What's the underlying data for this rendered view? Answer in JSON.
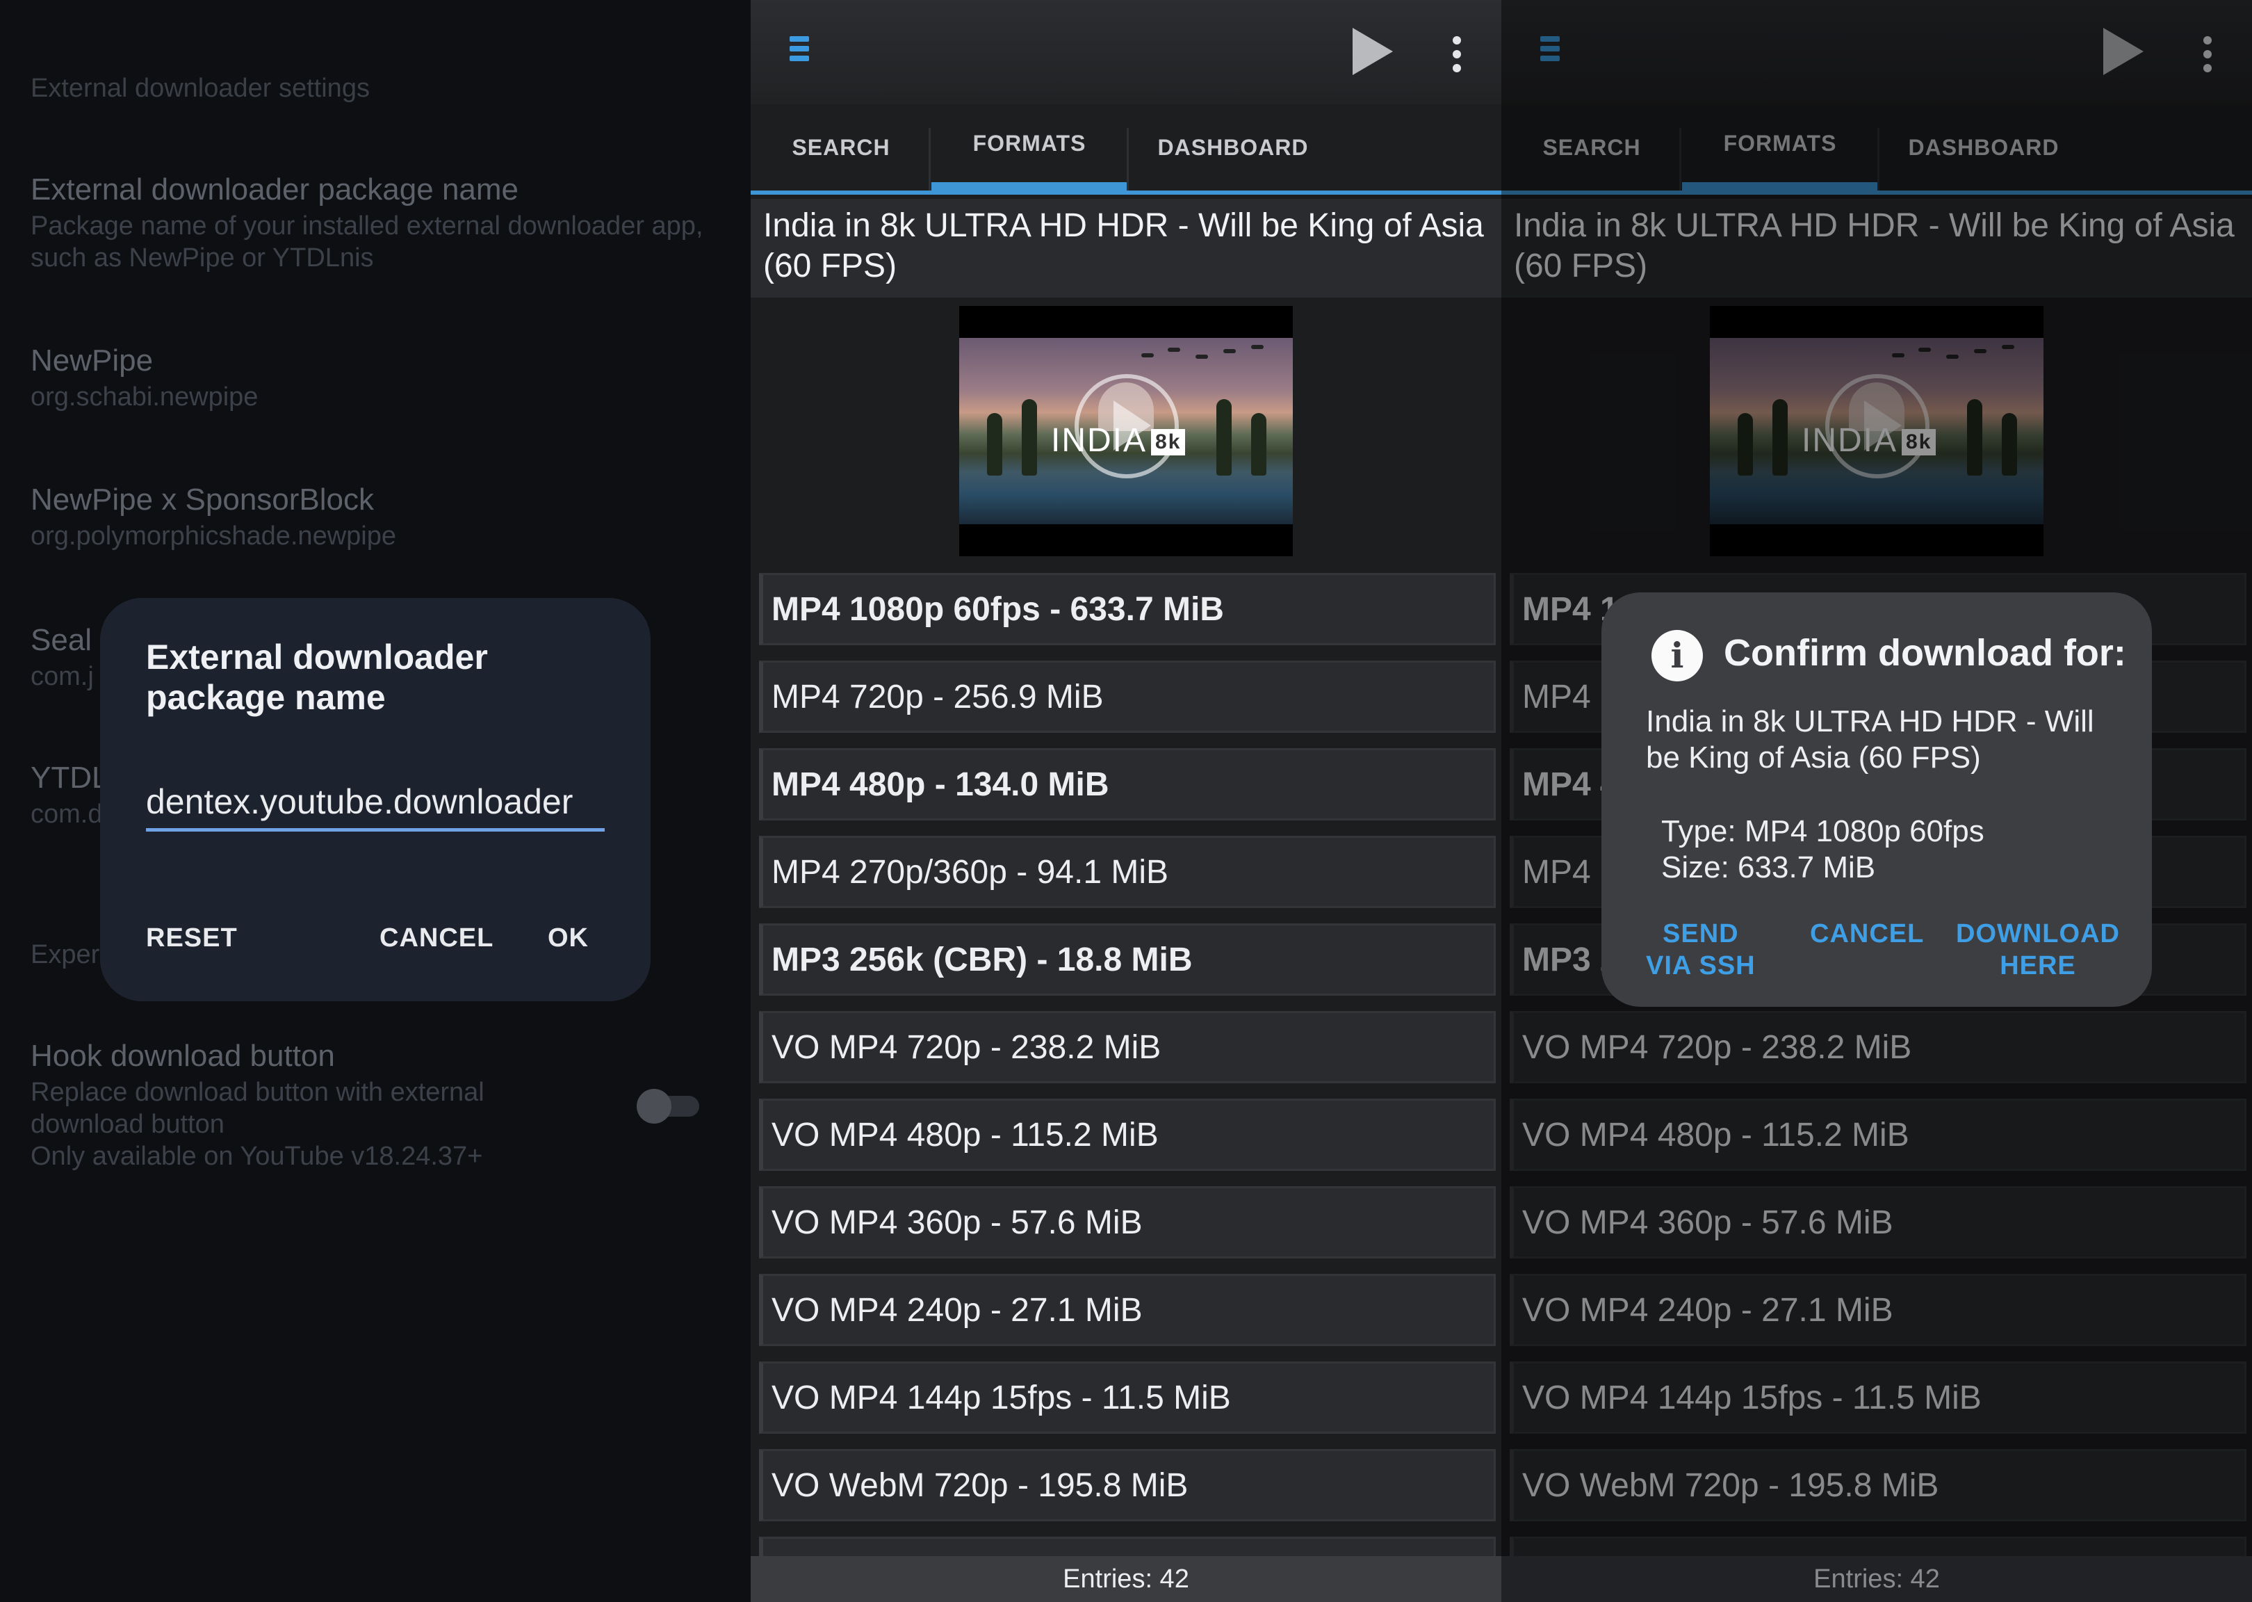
{
  "settings": {
    "category": "External downloader settings",
    "prefs": [
      {
        "title": "External downloader package name",
        "summary": "Package name of your installed external downloader app,\nsuch as NewPipe or YTDLnis"
      },
      {
        "title": "NewPipe",
        "summary": "org.schabi.newpipe"
      },
      {
        "title": "NewPipe x SponsorBlock",
        "summary": "org.polymorphicshade.newpipe"
      },
      {
        "title": "Seal",
        "summary": "com.j"
      },
      {
        "title": "YTDL",
        "summary": "com.d"
      },
      {
        "title": "Exper",
        "summary": ""
      },
      {
        "title": "Hook download button",
        "summary": "Replace download button with external\ndownload button\nOnly available on YouTube v18.24.37+"
      }
    ],
    "hook_toggle_on": false,
    "dialog": {
      "title": "External downloader package name",
      "value": "dentex.youtube.downloader",
      "reset": "RESET",
      "cancel": "CANCEL",
      "ok": "OK"
    }
  },
  "app": {
    "tabs": [
      "SEARCH",
      "FORMATS",
      "DASHBOARD"
    ],
    "selected_tab": "FORMATS",
    "video_title": "India in 8k ULTRA HD HDR - Will be King of Asia (60 FPS)",
    "thumbnail_logo": "INDIA",
    "thumbnail_badge": "8k",
    "formats": [
      {
        "label": "MP4 1080p 60fps - 633.7 MiB",
        "bold": true
      },
      {
        "label": "MP4 720p - 256.9 MiB",
        "bold": false
      },
      {
        "label": "MP4 480p - 134.0 MiB",
        "bold": true
      },
      {
        "label": "MP4 270p/360p - 94.1 MiB",
        "bold": false
      },
      {
        "label": "MP3 256k (CBR) - 18.8 MiB",
        "bold": true
      },
      {
        "label": "VO MP4 720p - 238.2 MiB",
        "bold": false
      },
      {
        "label": "VO MP4 480p - 115.2 MiB",
        "bold": false
      },
      {
        "label": "VO MP4 360p - 57.6 MiB",
        "bold": false
      },
      {
        "label": "VO MP4 240p - 27.1 MiB",
        "bold": false
      },
      {
        "label": "VO MP4 144p 15fps - 11.5 MiB",
        "bold": false
      },
      {
        "label": "VO WebM 720p - 195.8 MiB",
        "bold": false
      }
    ],
    "entries": "Entries: 42",
    "confirm": {
      "title": "Confirm download for:",
      "body": "India in 8k ULTRA HD HDR - Will be King of Asia (60 FPS)",
      "meta": "Type: MP4 1080p 60fps\nSize: 633.7 MiB",
      "send_ssh": "SEND\nVIA SSH",
      "cancel": "CANCEL",
      "download_here": "DOWNLOAD\nHERE"
    }
  },
  "colors": {
    "accent": "#3e96d6",
    "dialog_link": "#3f9fe6",
    "field_underline": "#6fa3e6"
  }
}
